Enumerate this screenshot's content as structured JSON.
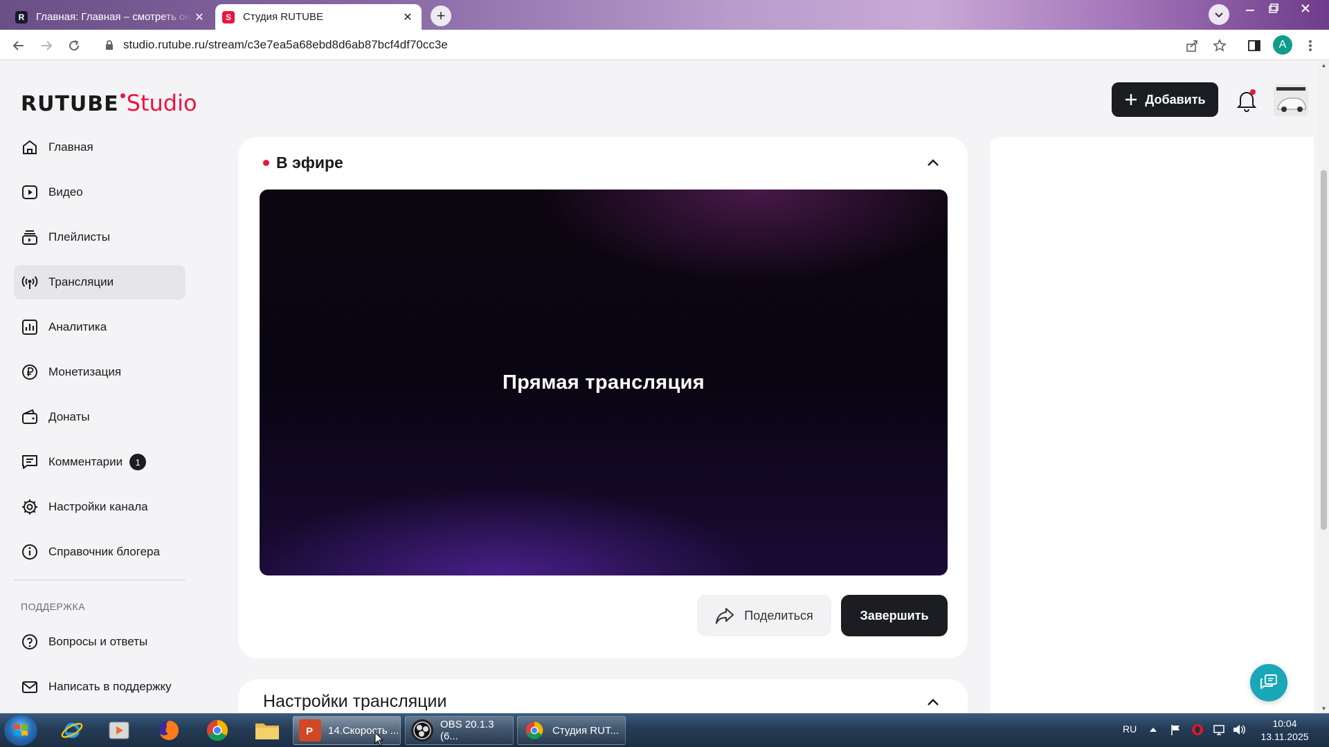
{
  "browser": {
    "tabs": [
      {
        "title": "Главная: Главная – смотреть онлайн",
        "close": "✕"
      },
      {
        "title": "Студия RUTUBE",
        "close": "✕"
      }
    ],
    "new_tab": "+",
    "url": "studio.rutube.ru/stream/c3e7ea5a68ebd8d6ab87bcf4df70cc3e",
    "profile_initial": "A"
  },
  "header": {
    "logo_main": "RUTUBE",
    "logo_studio": "Studio",
    "add_button": "Добавить"
  },
  "sidebar": {
    "items": [
      {
        "label": "Главная"
      },
      {
        "label": "Видео"
      },
      {
        "label": "Плейлисты"
      },
      {
        "label": "Трансляции"
      },
      {
        "label": "Аналитика"
      },
      {
        "label": "Монетизация"
      },
      {
        "label": "Донаты"
      },
      {
        "label": "Комментарии",
        "count": "1"
      },
      {
        "label": "Настройки канала"
      },
      {
        "label": "Справочник блогера"
      }
    ],
    "support_heading": "ПОДДЕРЖКА",
    "support_items": [
      {
        "label": "Вопросы и ответы"
      },
      {
        "label": "Написать в поддержку"
      }
    ]
  },
  "live": {
    "title": "В эфире",
    "player_title": "Прямая трансляция",
    "share_button": "Поделиться",
    "end_button": "Завершить"
  },
  "settings": {
    "title": "Настройки трансляции"
  },
  "colors": {
    "accent": "#ed143b",
    "dark_button": "#1b1d22",
    "help_fab": "#1aa7b8"
  },
  "taskbar": {
    "tasks": [
      {
        "label": "14.Скорость ..."
      },
      {
        "label": "OBS 20.1.3 (6..."
      },
      {
        "label": "Студия RUT..."
      }
    ],
    "lang": "RU",
    "time": "10:04",
    "date": "13.11.2025"
  }
}
